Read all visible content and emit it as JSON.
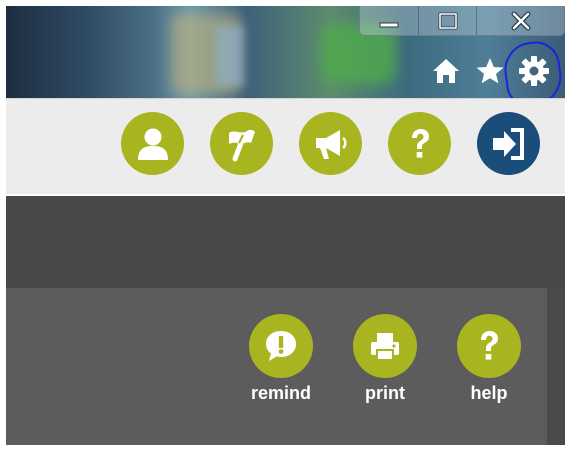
{
  "colors": {
    "green": "#a9b520",
    "blue": "#1a4d7a",
    "annotation": "#1d24d8"
  },
  "browser": {
    "window_controls": [
      {
        "name": "minimize",
        "icon": "minimize-icon"
      },
      {
        "name": "maximize",
        "icon": "maximize-icon"
      },
      {
        "name": "close",
        "icon": "close-icon"
      }
    ],
    "toolbar": [
      {
        "name": "home",
        "icon": "home-icon"
      },
      {
        "name": "favorites",
        "icon": "star-icon"
      },
      {
        "name": "tools",
        "icon": "gear-icon",
        "highlighted": true
      }
    ]
  },
  "header": {
    "icons": [
      {
        "name": "profile",
        "icon": "user-icon",
        "color": "green"
      },
      {
        "name": "flag",
        "icon": "flag-icon",
        "color": "green"
      },
      {
        "name": "announcements",
        "icon": "megaphone-icon",
        "color": "green"
      },
      {
        "name": "help",
        "icon": "question-icon",
        "color": "green"
      },
      {
        "name": "sign-out",
        "icon": "sign-out-icon",
        "color": "blue"
      }
    ]
  },
  "panel": {
    "actions": [
      {
        "label": "remind",
        "icon": "alert-bubble-icon"
      },
      {
        "label": "print",
        "icon": "printer-icon"
      },
      {
        "label": "help",
        "icon": "question-icon"
      }
    ]
  }
}
